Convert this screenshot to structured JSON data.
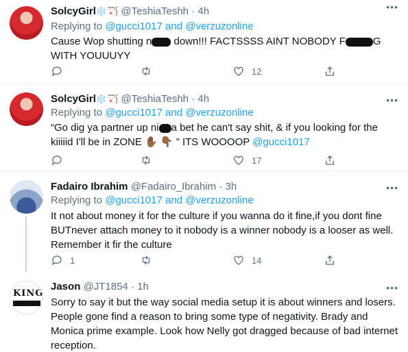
{
  "tweets": [
    {
      "name": "SolcyGirl",
      "emoji": "❄️🏹",
      "handle": "@TeshiaTeshh",
      "time": "4h",
      "reply_prefix": "Replying to",
      "reply_user1": "@gucci1017",
      "reply_and": "and",
      "reply_user2": "@verzuzonline",
      "text_a": "Cause Wop shutting n",
      "text_b": " down!!! FACTSSSS AINT NOBODY F",
      "text_c": "G WITH YOUUUYY",
      "replies": "",
      "retweets": "",
      "likes": "12"
    },
    {
      "name": "SolcyGirl",
      "emoji": "❄️🏹",
      "handle": "@TeshiaTeshh",
      "time": "4h",
      "reply_prefix": "Replying to",
      "reply_user1": "@gucci1017",
      "reply_and": "and",
      "reply_user2": "@verzuzonline",
      "text_a": "“Go dig ya partner up ni",
      "text_b": "a bet he can't say shit, & if you looking for the kiiiiid I'll be in ZONE ",
      "text_emoji": "✋🏾 👇🏾",
      "text_c": " ” ITS WOOOOP ",
      "text_mention": "@gucci1017",
      "replies": "",
      "retweets": "",
      "likes": "17"
    },
    {
      "name": "Fadairo Ibrahim",
      "handle": "@Fadairo_Ibrahim",
      "time": "3h",
      "reply_prefix": "Replying to",
      "reply_user1": "@gucci1017",
      "reply_and": "and",
      "reply_user2": "@verzuzonline",
      "text": "It not about money it for the culture if you wanna do it fine,if you dont fine BUTnever attach money to it nobody is a winner nobody is a looser as well. Remember it fir the culture",
      "replies": "1",
      "retweets": "",
      "likes": "14"
    },
    {
      "name": "Jason",
      "handle": "@JT1854",
      "time": "1h",
      "avatar_text": "KING",
      "text": "Sorry to say it but the way social media setup it is about winners and losers. People gone find a reason to bring some type of negativity. Brady and Monica prime example. Look how Nelly got dragged because of bad internet reception."
    }
  ],
  "dot": "·",
  "more_glyph": "•••",
  "colors": {
    "accent": "#1da1f2",
    "secondary_text": "#5b7083",
    "divider": "#e6ecf0"
  }
}
